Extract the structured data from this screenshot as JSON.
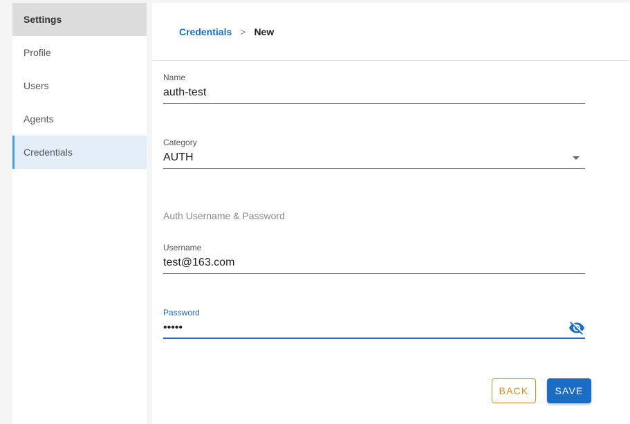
{
  "sidebar": {
    "header": "Settings",
    "items": [
      {
        "label": "Profile"
      },
      {
        "label": "Users"
      },
      {
        "label": "Agents"
      },
      {
        "label": "Credentials"
      }
    ]
  },
  "breadcrumb": {
    "parent": "Credentials",
    "separator": ">",
    "current": "New"
  },
  "form": {
    "name": {
      "label": "Name",
      "value": "auth-test"
    },
    "category": {
      "label": "Category",
      "value": "AUTH"
    },
    "section_title": "Auth Username & Password",
    "username": {
      "label": "Username",
      "value": "test@163.com"
    },
    "password": {
      "label": "Password",
      "value": "•••••"
    }
  },
  "actions": {
    "back_label": "BACK",
    "save_label": "SAVE"
  },
  "colors": {
    "accent": "#1a6dc4",
    "back_button": "#e08a1a",
    "active_sidebar_border": "#4a9fe0"
  },
  "icons": {
    "password_toggle": "eye-off-icon",
    "category_dropdown": "chevron-down-icon"
  }
}
